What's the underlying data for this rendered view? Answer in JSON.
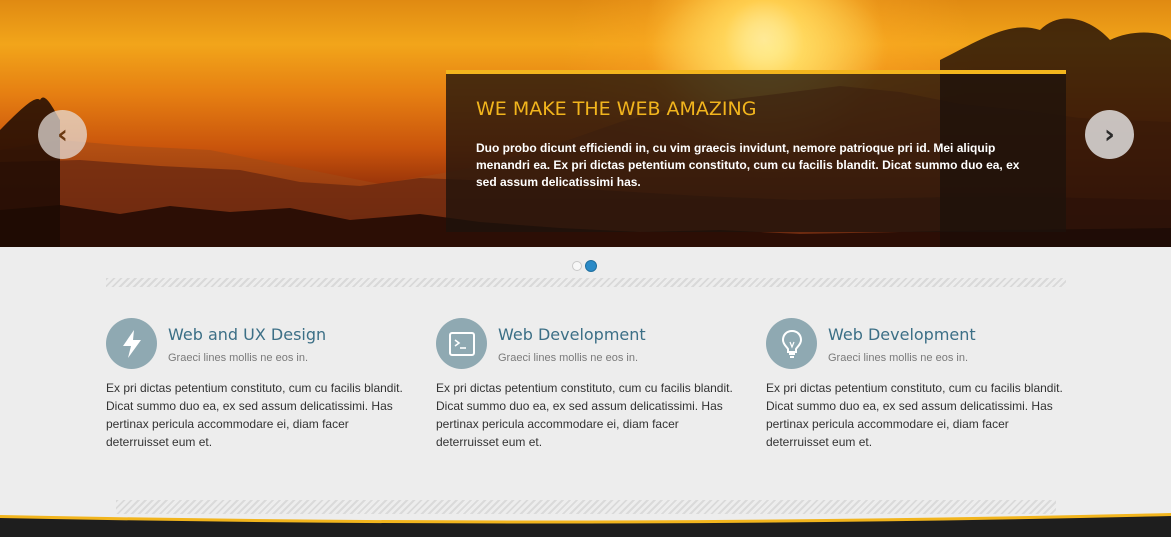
{
  "hero": {
    "caption_title": "WE MAKE THE WEB AMAZING",
    "caption_text": "Duo probo dicunt efficiendi in, cu vim graecis invidunt, nemore patrioque pri id. Mei aliquip menandri ea. Ex pri dictas petentium constituto, cum cu facilis blandit. Dicat summo duo ea, ex sed assum delicatissimi has.",
    "prev_icon": "‹",
    "next_icon": "›",
    "accent_color": "#f2b51d"
  },
  "slider": {
    "slide_count": 2,
    "active_slide": 2
  },
  "features": [
    {
      "icon": "lightning-icon",
      "title": "Web and UX Design",
      "subtitle": "Graeci lines mollis ne eos in.",
      "body": "Ex pri dictas petentium constituto, cum cu facilis blandit. Dicat summo duo ea, ex sed assum delicatissimi. Has pertinax pericula accommodare ei, diam facer deterruisset eum et."
    },
    {
      "icon": "terminal-icon",
      "title": "Web Development",
      "subtitle": "Graeci lines mollis ne eos in.",
      "body": "Ex pri dictas petentium constituto, cum cu facilis blandit. Dicat summo duo ea, ex sed assum delicatissimi. Has pertinax pericula accommodare ei, diam facer deterruisset eum et."
    },
    {
      "icon": "lightbulb-icon",
      "title": "Web Development",
      "subtitle": "Graeci lines mollis ne eos in.",
      "body": "Ex pri dictas petentium constituto, cum cu facilis blandit. Dicat summo duo ea, ex sed assum delicatissimi. Has pertinax pericula accommodare ei, diam facer deterruisset eum et."
    }
  ],
  "colors": {
    "feature_title": "#3c6f86",
    "icon_circle": "#8fa9b2",
    "active_dot": "#2a8ac7"
  }
}
